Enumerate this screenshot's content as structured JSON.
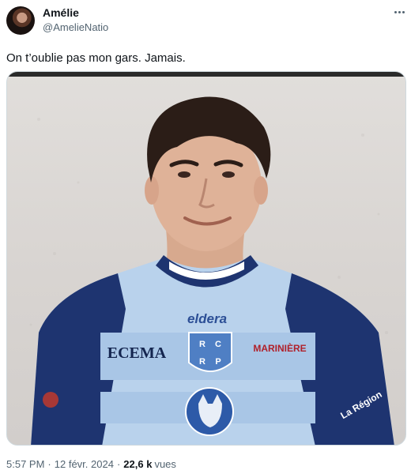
{
  "author": {
    "display_name": "Amélie",
    "handle": "@AmelieNatio"
  },
  "tweet": {
    "text": "On t’oublie pas mon gars. Jamais."
  },
  "media": {
    "jersey_sponsors": [
      "eldera",
      "ECEMA",
      "MARINIÈRE",
      "La Région"
    ],
    "jersey_badge": [
      "R",
      "C",
      "R",
      "P"
    ]
  },
  "meta": {
    "time": "5:57 PM",
    "separator": "·",
    "date": "12 févr. 2024",
    "views_count": "22,6 k",
    "views_label": "vues"
  },
  "colors": {
    "jersey_navy": "#1e3470",
    "jersey_light_blue": "#b9d2ec",
    "muted_text": "#536471"
  }
}
